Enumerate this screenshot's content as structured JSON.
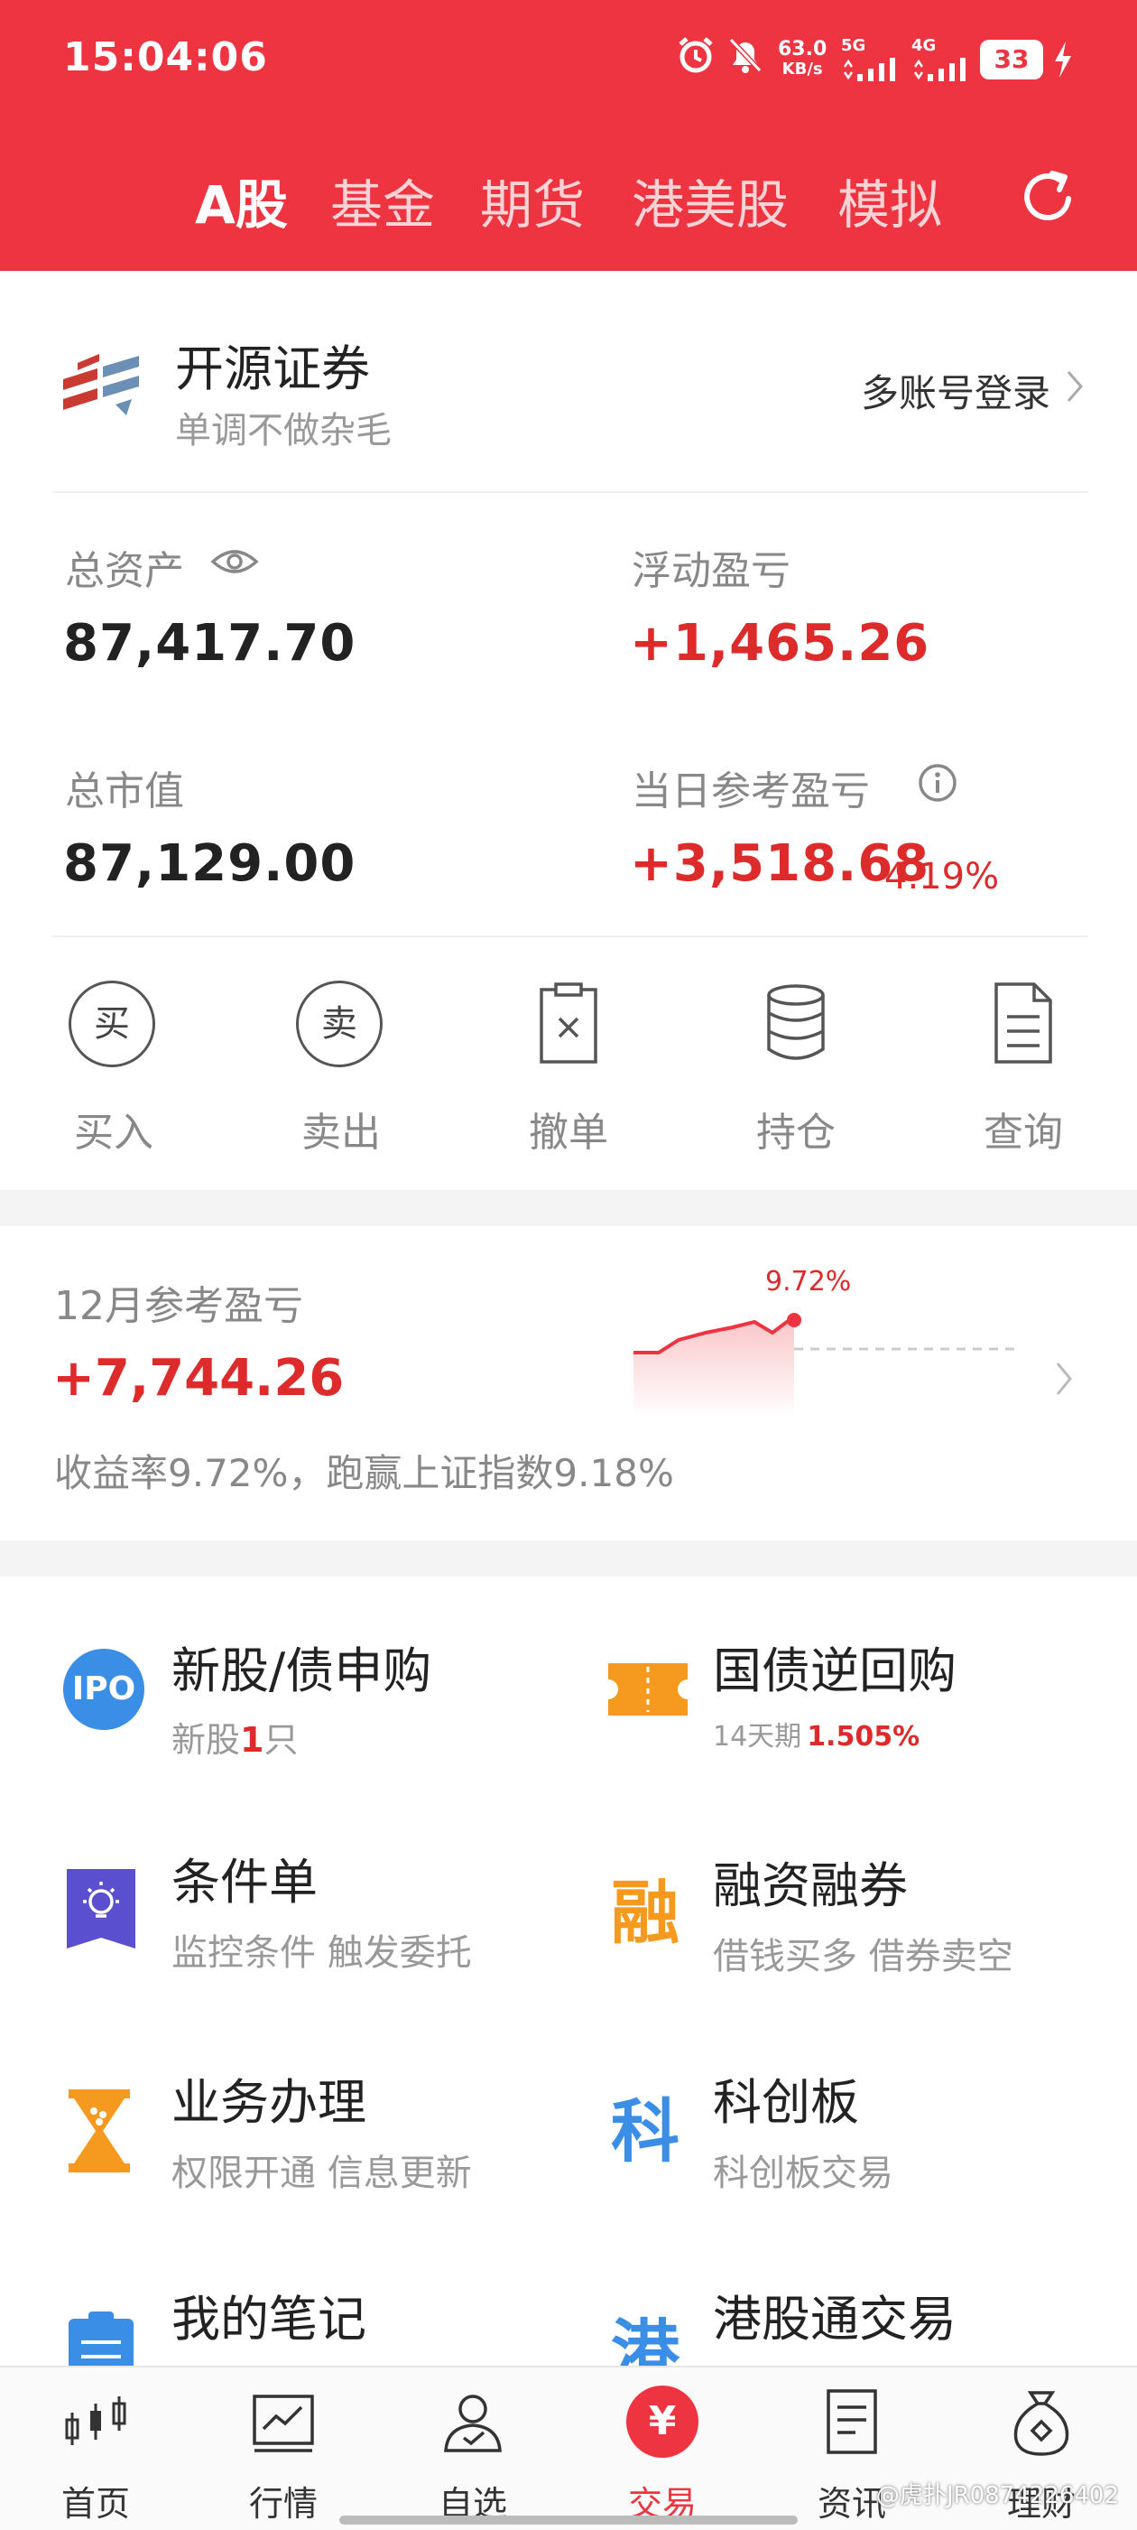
{
  "status_bar": {
    "time": "15:04:06",
    "net_speed": "63.0",
    "net_unit": "KB/s",
    "sig1": "5G",
    "sig2": "4G",
    "battery": "33"
  },
  "tabs": [
    "A股",
    "基金",
    "期货",
    "港美股",
    "模拟"
  ],
  "broker": {
    "name": "开源证券",
    "slogan": "单调不做杂毛",
    "multi_login": "多账号登录"
  },
  "assets": {
    "total_label": "总资产",
    "total_value": "87,417.70",
    "float_label": "浮动盈亏",
    "float_value": "+1,465.26",
    "market_label": "总市值",
    "market_value": "87,129.00",
    "daily_label": "当日参考盈亏",
    "daily_value": "+3,518.68",
    "daily_pct": "4.19%"
  },
  "actions": [
    {
      "label": "买入",
      "glyph": "买",
      "icon": "buy-icon"
    },
    {
      "label": "卖出",
      "glyph": "卖",
      "icon": "sell-icon"
    },
    {
      "label": "撤单",
      "icon": "cancel-order-icon"
    },
    {
      "label": "持仓",
      "icon": "positions-icon"
    },
    {
      "label": "查询",
      "icon": "query-icon"
    }
  ],
  "monthly": {
    "title": "12月参考盈亏",
    "value": "+7,744.26",
    "desc": "收益率9.72%，跑赢上证指数9.18%",
    "chart_label": "9.72%"
  },
  "services": [
    {
      "title": "新股/债申购",
      "sub_prefix": "新股",
      "sub_highlight": "1",
      "sub_suffix": "只",
      "icon_text": "IPO"
    },
    {
      "title": "国债逆回购",
      "sub_prefix": "14天期",
      "sub_highlight": "1.505%",
      "sub_suffix": ""
    },
    {
      "title": "条件单",
      "sub": "监控条件 触发委托"
    },
    {
      "title": "融资融券",
      "sub": "借钱买多 借券卖空",
      "icon_text": "融"
    },
    {
      "title": "业务办理",
      "sub": "权限开通 信息更新"
    },
    {
      "title": "科创板",
      "sub": "科创板交易",
      "icon_text": "科"
    },
    {
      "title": "我的笔记"
    },
    {
      "title": "港股通交易",
      "icon_text": "港"
    }
  ],
  "nav": [
    {
      "label": "首页",
      "icon": "home-candles-icon"
    },
    {
      "label": "行情",
      "icon": "market-chart-icon"
    },
    {
      "label": "自选",
      "icon": "watchlist-person-icon"
    },
    {
      "label": "交易",
      "icon": "trade-yen-icon",
      "glyph": "¥"
    },
    {
      "label": "资讯",
      "icon": "news-doc-icon"
    },
    {
      "label": "理财",
      "icon": "wealth-bag-icon"
    }
  ],
  "watermark": "@虎扑JR0874226402",
  "colors": {
    "brand_red": "#ee3440",
    "gain_red": "#dd2b2b",
    "blue": "#3a8ee6",
    "orange": "#f59a1e",
    "purple": "#5a4fcf"
  }
}
